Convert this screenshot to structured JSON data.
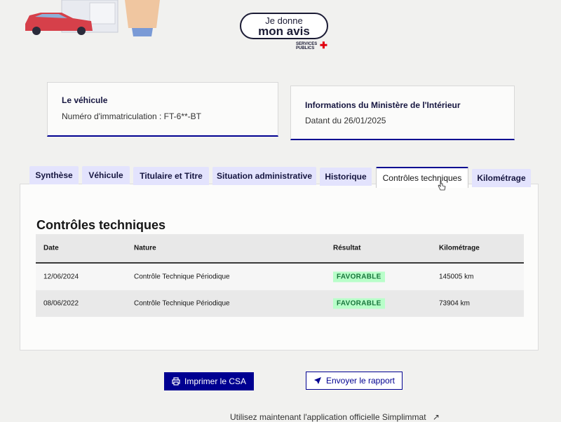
{
  "feedback": {
    "line1": "Je donne",
    "line2": "mon avis"
  },
  "services_logo": {
    "line1": "SERVICES",
    "line2": "PUBLICS"
  },
  "vehicle_card": {
    "title": "Le véhicule",
    "plate_text": "Numéro d'immatriculation : FT-6**-BT"
  },
  "info_card": {
    "title": "Informations du Ministère de l'Intérieur",
    "date_text": "Datant du 26/01/2025"
  },
  "tabs": [
    {
      "label": "Synthèse"
    },
    {
      "label": "Véhicule"
    },
    {
      "label": "Titulaire et Titre"
    },
    {
      "label": "Situation administrative"
    },
    {
      "label": "Historique"
    },
    {
      "label": "Contrôles techniques"
    },
    {
      "label": "Kilométrage"
    }
  ],
  "active_tab": "Contrôles techniques",
  "section": {
    "title": "Contrôles techniques"
  },
  "table": {
    "headers": [
      "Date",
      "Nature",
      "Résultat",
      "Kilométrage"
    ],
    "rows": [
      {
        "date": "12/06/2024",
        "nature": "Contrôle Technique Périodique",
        "result": "FAVORABLE",
        "km": "145005 km"
      },
      {
        "date": "08/06/2022",
        "nature": "Contrôle Technique Périodique",
        "result": "FAVORABLE",
        "km": "73904 km"
      }
    ]
  },
  "actions": {
    "print_label": "Imprimer le CSA",
    "send_label": "Envoyer le rapport"
  },
  "footer": {
    "text": "Utilisez maintenant l'application officielle Simplimmat"
  },
  "colors": {
    "primary": "#000091",
    "success_bg": "#b8fec9",
    "success_text": "#18753c",
    "tab_bg": "#e3e3fd"
  },
  "icons": {
    "print": "printer-icon",
    "send": "send-icon",
    "external": "external-link-icon"
  }
}
